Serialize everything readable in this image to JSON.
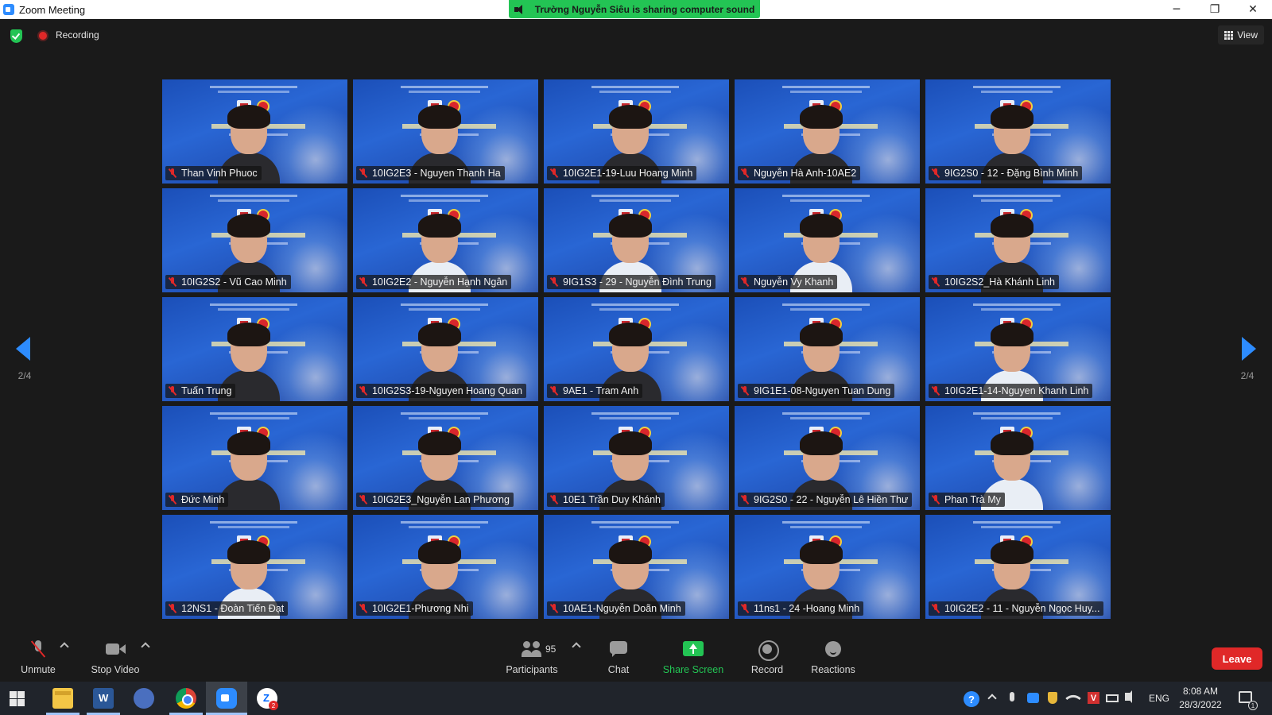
{
  "window": {
    "title": "Zoom Meeting",
    "controls": [
      "─",
      "❐",
      "✕"
    ]
  },
  "share_banner": "Trường Nguyễn Siêu is sharing computer sound",
  "meeting_bar": {
    "recording_label": "Recording",
    "view_label": "View"
  },
  "pagination": {
    "left": "2/4",
    "right": "2/4"
  },
  "participants": [
    {
      "name": "Than Vinh Phuoc",
      "muted": true,
      "shirt": "dark"
    },
    {
      "name": "10IG2E3 - Nguyen Thanh Ha",
      "muted": true,
      "shirt": "dark"
    },
    {
      "name": "10IG2E1-19-Luu Hoang Minh",
      "muted": true,
      "shirt": "dark"
    },
    {
      "name": "Nguyễn Hà Anh-10AE2",
      "muted": true,
      "shirt": "dark"
    },
    {
      "name": "9IG2S0 - 12 - Đặng Bình Minh",
      "muted": true,
      "shirt": "dark"
    },
    {
      "name": "10IG2S2 - Vũ Cao Minh",
      "muted": true,
      "shirt": "dark"
    },
    {
      "name": "10IG2E2 - Nguyễn Hạnh Ngân",
      "muted": true,
      "shirt": "light"
    },
    {
      "name": "9IG1S3 - 29 - Nguyễn Đình Trung",
      "muted": true,
      "shirt": "light"
    },
    {
      "name": "Nguyễn Vy Khanh",
      "muted": true,
      "shirt": "light"
    },
    {
      "name": "10IG2S2_Hà Khánh Linh",
      "muted": true,
      "shirt": "dark"
    },
    {
      "name": "Tuấn Trung",
      "muted": true,
      "shirt": "dark"
    },
    {
      "name": "10IG2S3-19-Nguyen Hoang Quan",
      "muted": true,
      "shirt": "dark"
    },
    {
      "name": "9AE1 - Tram Anh",
      "muted": true,
      "shirt": "dark"
    },
    {
      "name": "9IG1E1-08-Nguyen Tuan Dung",
      "muted": true,
      "shirt": "dark"
    },
    {
      "name": "10IG2E1-14-Nguyen Khanh Linh",
      "muted": true,
      "shirt": "light"
    },
    {
      "name": "Đức Minh",
      "muted": true,
      "shirt": "dark"
    },
    {
      "name": "10IG2E3_Nguyễn Lan Phương",
      "muted": true,
      "shirt": "dark"
    },
    {
      "name": "10E1 Trần Duy Khánh",
      "muted": true,
      "shirt": "dark"
    },
    {
      "name": "9IG2S0 - 22 - Nguyễn Lê Hiền Thư",
      "muted": true,
      "shirt": "dark"
    },
    {
      "name": "Phan Trà My",
      "muted": true,
      "shirt": "light"
    },
    {
      "name": "12NS1 - Đoàn Tiến Đạt",
      "muted": true,
      "shirt": "light"
    },
    {
      "name": "10IG2E1-Phương Nhi",
      "muted": true,
      "shirt": "dark"
    },
    {
      "name": "10AE1-Nguyễn Doãn Minh",
      "muted": true,
      "shirt": "dark"
    },
    {
      "name": "11ns1 - 24 -Hoang Minh",
      "muted": true,
      "shirt": "dark"
    },
    {
      "name": "10IG2E2 - 11 - Nguyễn Ngọc Huy...",
      "muted": true,
      "shirt": "dark"
    }
  ],
  "toolbar": {
    "unmute": "Unmute",
    "stop_video": "Stop Video",
    "participants": "Participants",
    "participant_count": "95",
    "chat": "Chat",
    "share_screen": "Share Screen",
    "record": "Record",
    "reactions": "Reactions",
    "leave": "Leave"
  },
  "taskbar": {
    "language": "ENG",
    "time": "8:08 AM",
    "date": "28/3/2022",
    "zalo_badge": "2",
    "notification_count": "1",
    "help_glyph": "?",
    "vpn_glyph": "V"
  },
  "colors": {
    "accent_blue": "#2d8cff",
    "share_green": "#23c454",
    "leave_red": "#e02828",
    "muted_red": "#e02828"
  }
}
